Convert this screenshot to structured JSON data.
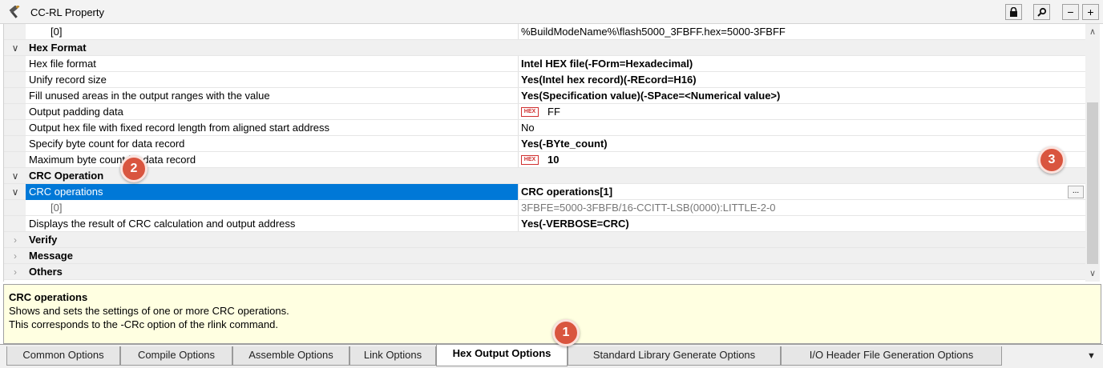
{
  "window": {
    "title": "CC-RL Property"
  },
  "toolbar": {
    "lock": "lock-icon",
    "search": "magnifier-icon",
    "collapse": "−",
    "expand": "+"
  },
  "grid": {
    "rows": {
      "r0": {
        "name": "[0]",
        "value": "%BuildModeName%\\flash5000_3FBFF.hex=5000-3FBFF"
      },
      "r1": {
        "name": "Hex Format"
      },
      "r2": {
        "name": "Hex file format",
        "value": "Intel HEX file(-FOrm=Hexadecimal)"
      },
      "r3": {
        "name": "Unify record size",
        "value": "Yes(Intel hex record)(-REcord=H16)"
      },
      "r4": {
        "name": "Fill unused areas in the output ranges with the value",
        "value": "Yes(Specification value)(-SPace=<Numerical value>)"
      },
      "r5": {
        "name": "Output padding data",
        "badge": "HEX",
        "value": "FF"
      },
      "r6": {
        "name": "Output hex file with fixed record length from aligned start address",
        "value": "No"
      },
      "r7": {
        "name": "Specify byte count for data record",
        "value": "Yes(-BYte_count)"
      },
      "r8": {
        "name": "Maximum byte count for data record",
        "badge": "HEX",
        "value": "10"
      },
      "r9": {
        "name": "CRC Operation"
      },
      "r10": {
        "name": "CRC operations",
        "value": "CRC operations[1]",
        "button": "..."
      },
      "r11": {
        "name": "[0]",
        "value": "3FBFE=5000-3FBFB/16-CCITT-LSB(0000):LITTLE-2-0"
      },
      "r12": {
        "name": "Displays the result of CRC calculation and output address",
        "value": "Yes(-VERBOSE=CRC)"
      },
      "r13": {
        "name": "Verify"
      },
      "r14": {
        "name": "Message"
      },
      "r15": {
        "name": "Others"
      }
    }
  },
  "description": {
    "title": "CRC operations",
    "line1": "Shows and sets the settings of one or more CRC operations.",
    "line2": "This corresponds to the -CRc option of the rlink command."
  },
  "tabs": {
    "t0": "Common Options",
    "t1": "Compile Options",
    "t2": "Assemble Options",
    "t3": "Link Options",
    "t4": "Hex Output Options",
    "t5": "Standard Library Generate Options",
    "t6": "I/O Header File Generation Options"
  },
  "callouts": {
    "c1": "1",
    "c2": "2",
    "c3": "3"
  },
  "colors": {
    "selection": "#0078d7",
    "callout": "#d9553f",
    "description_bg": "#ffffe1"
  }
}
